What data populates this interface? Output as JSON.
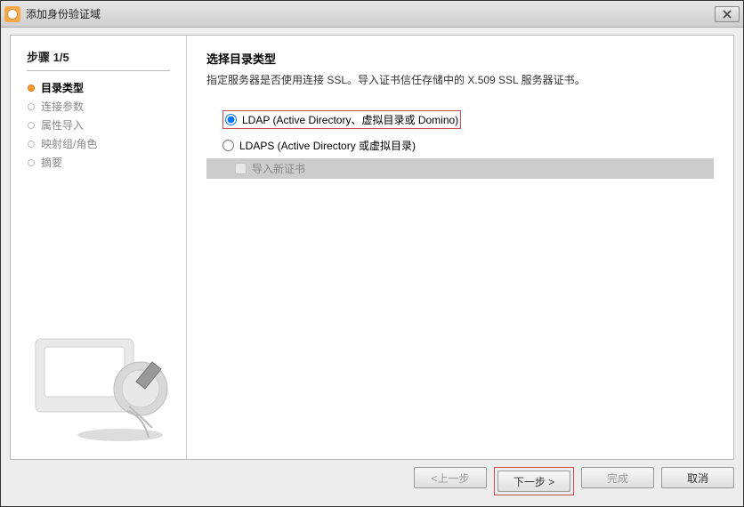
{
  "title": "添加身份验证域",
  "sidebar": {
    "step_label": "步骤 1/5",
    "items": [
      {
        "label": "目录类型",
        "active": true
      },
      {
        "label": "连接参数",
        "active": false
      },
      {
        "label": "属性导入",
        "active": false
      },
      {
        "label": "映射组/角色",
        "active": false
      },
      {
        "label": "摘要",
        "active": false
      }
    ]
  },
  "main": {
    "heading": "选择目录类型",
    "description": "指定服务器是否使用连接 SSL。导入证书信任存储中的 X.509 SSL 服务器证书。",
    "options": [
      {
        "label": "LDAP (Active Directory、虚拟目录或 Domino)",
        "selected": true
      },
      {
        "label": "LDAPS (Active Directory 或虚拟目录)",
        "selected": false
      }
    ],
    "import_cert_label": "导入新证书"
  },
  "buttons": {
    "back": "<上一步",
    "next": "下一步 >",
    "finish": "完成",
    "cancel": "取消"
  }
}
